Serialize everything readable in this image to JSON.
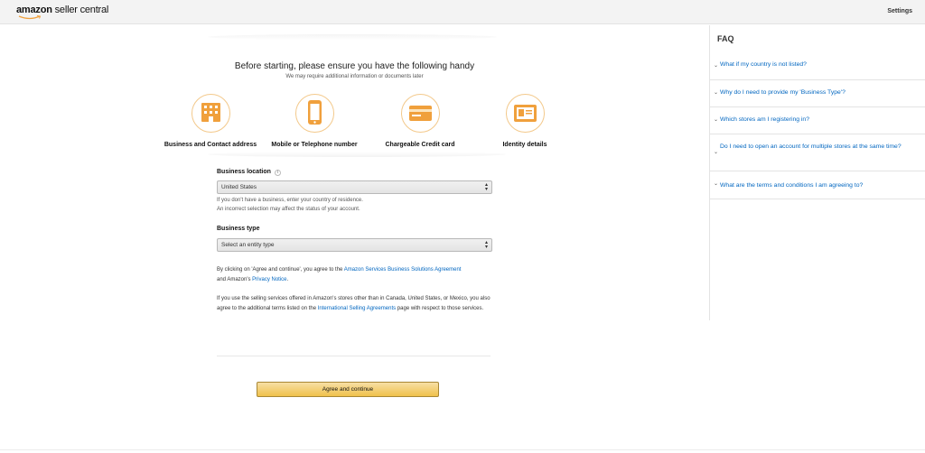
{
  "header": {
    "logo_amazon": "amazon",
    "logo_sc": " seller central",
    "settings_label": "Settings"
  },
  "main": {
    "headline": "Before starting, please ensure you have the following handy",
    "subline": "We may require additional information or documents later",
    "requirements": [
      {
        "label": "Business and Contact address",
        "icon": "building-icon"
      },
      {
        "label": "Mobile or Telephone number",
        "icon": "mobile-phone-icon"
      },
      {
        "label": "Chargeable Credit card",
        "icon": "credit-card-icon"
      },
      {
        "label": "Identity details",
        "icon": "id-card-icon"
      }
    ],
    "business_location": {
      "label": "Business location",
      "value": "United States",
      "help1": "If you don't have a business, enter your country of residence.",
      "help2": "An incorrect selection may affect the status of your account."
    },
    "business_type": {
      "label": "Business type",
      "value": "Select an entity type"
    },
    "agreement": {
      "p1_before": "By clicking on 'Agree and continue', you agree to the ",
      "p1_link": "Amazon Services Business Solutions Agreement",
      "p1_mid": " and Amazon's ",
      "p1_link2": "Privacy Notice",
      "p1_end": ".",
      "p2_before": "If you use the selling services offered in Amazon's stores other than in Canada, United States, or Mexico, you also agree to the additional terms listed on the ",
      "p2_link": "International Selling Agreements",
      "p2_end": " page with respect to those services."
    },
    "cta_label": "Agree and continue"
  },
  "faq": {
    "title": "FAQ",
    "items": [
      "What if my country is not listed?",
      "Why do I need to provide my 'Business Type'?",
      "Which stores am I registering in?",
      "Do I need to open an account for multiple stores at the same time?",
      "What are the terms and conditions I am agreeing to?"
    ]
  },
  "colors": {
    "accent_orange": "#f0a03c",
    "link_blue": "#0066c0",
    "button_yellow": "#f0c14b"
  }
}
